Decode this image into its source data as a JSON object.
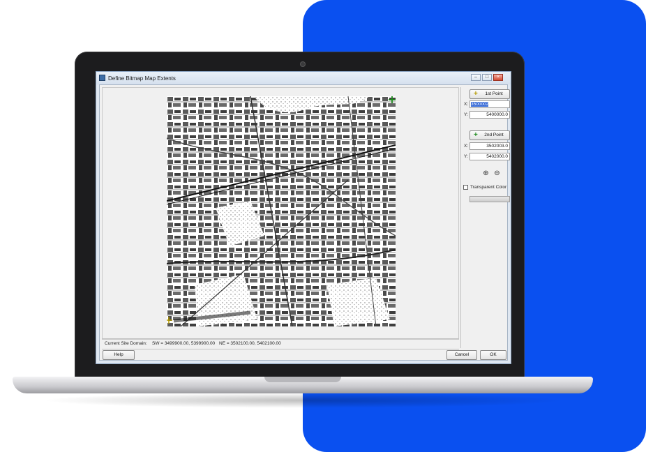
{
  "colors": {
    "accent_panel": "#0a50f0",
    "screen_bg": "#f0f0f0",
    "selection": "#3367d6"
  },
  "window": {
    "title": "Define Bitmap Map Extents",
    "controls": {
      "minimize": "–",
      "maximize": "□",
      "close": "×"
    }
  },
  "map": {
    "first_marker_icon": "crosshair-yellow-icon",
    "second_marker_icon": "crosshair-green-icon"
  },
  "panel": {
    "first_point_label": "1st Point",
    "x_label": "X:",
    "y_label": "Y:",
    "first_x": "3500002",
    "first_y": "5400000.0",
    "second_point_label": "2nd Point",
    "second_x": "3502003.0",
    "second_y": "5402000.0",
    "zoom_in_icon": "zoom-in-icon",
    "zoom_out_icon": "zoom-out-icon",
    "transparent_color_label": "Transparent Color"
  },
  "status": {
    "label": "Current Site Domain:",
    "sw": "SW = 3499900.00, 5399900.00",
    "ne": "NE = 3502100.00, 5402100.00"
  },
  "buttons": {
    "help": "Help",
    "cancel": "Cancel",
    "ok": "OK"
  }
}
